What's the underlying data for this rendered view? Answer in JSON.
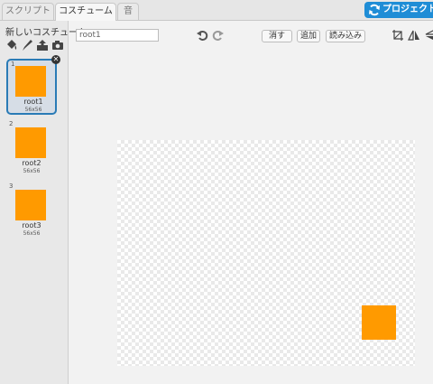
{
  "tabs": [
    {
      "label": "スクリプト"
    },
    {
      "label": "コスチューム"
    },
    {
      "label": "音"
    }
  ],
  "share_button": {
    "label": "プロジェクト"
  },
  "sidebar": {
    "new_costume_label": "新しいコスチューム:",
    "tools": [
      "paint-fill-icon",
      "brush-icon",
      "upload-icon",
      "camera-icon"
    ]
  },
  "costumes": [
    {
      "number": "1",
      "name": "root1",
      "size": "56x56",
      "selected": true
    },
    {
      "number": "2",
      "name": "root2",
      "size": "56x56",
      "selected": false
    },
    {
      "number": "3",
      "name": "root3",
      "size": "56x56",
      "selected": false
    }
  ],
  "editor": {
    "name_value": "root1",
    "clear_label": "消す",
    "add_label": "追加",
    "import_label": "読み込み"
  },
  "colors": {
    "accent": "#1f8dd6",
    "costume_fill": "#ff9a00",
    "selection_border": "#2a7bb6"
  }
}
